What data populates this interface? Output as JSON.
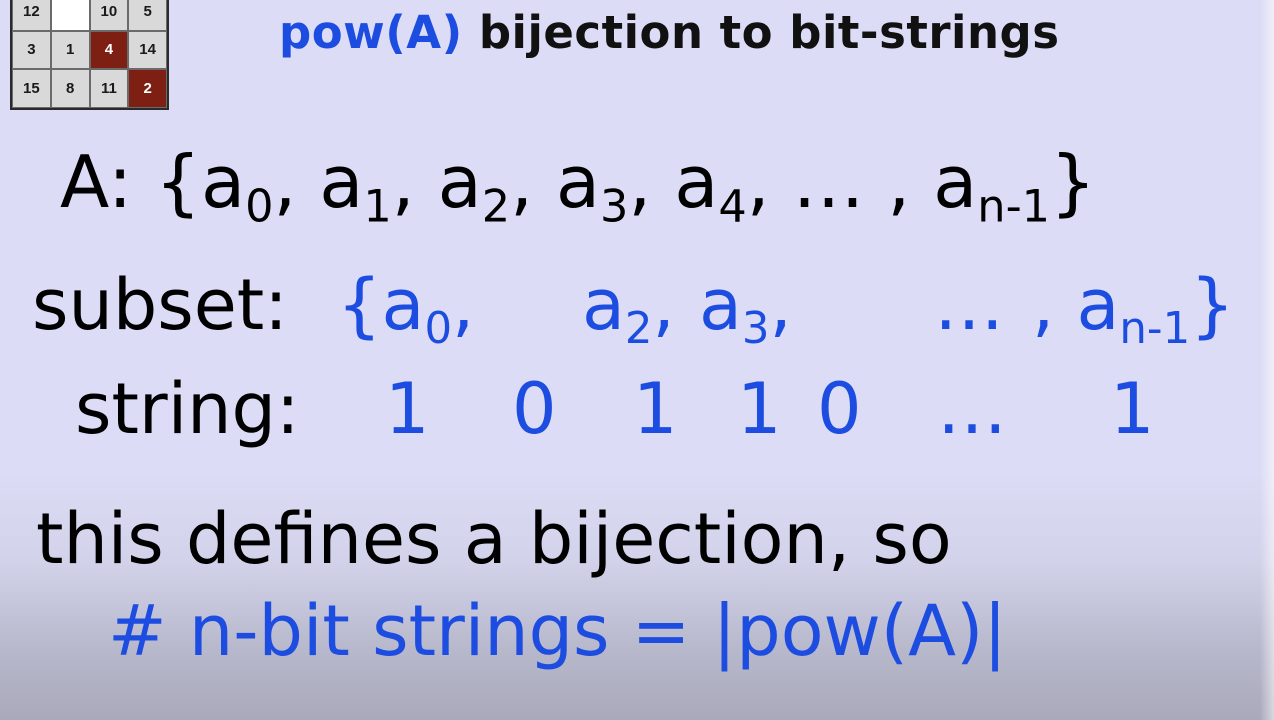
{
  "logo": {
    "tiles": [
      {
        "label": "12",
        "style": "normal"
      },
      {
        "label": "",
        "style": "blank"
      },
      {
        "label": "10",
        "style": "normal"
      },
      {
        "label": "5",
        "style": "normal"
      },
      {
        "label": "3",
        "style": "normal"
      },
      {
        "label": "1",
        "style": "normal"
      },
      {
        "label": "4",
        "style": "red"
      },
      {
        "label": "14",
        "style": "normal"
      },
      {
        "label": "15",
        "style": "normal"
      },
      {
        "label": "8",
        "style": "normal"
      },
      {
        "label": "11",
        "style": "normal"
      },
      {
        "label": "2",
        "style": "red"
      }
    ]
  },
  "title": {
    "highlight": "pow(A)",
    "rest": " bijection to bit-strings"
  },
  "set_line": {
    "prefix": "A:  {",
    "items": [
      {
        "base": "a",
        "sub": "0",
        "sep": ", "
      },
      {
        "base": "a",
        "sub": "1",
        "sep": ", "
      },
      {
        "base": "a",
        "sub": "2",
        "sep": ", "
      },
      {
        "base": "a",
        "sub": "3",
        "sep": ", "
      },
      {
        "base": "a",
        "sub": "4",
        "sep": ", … , "
      },
      {
        "base": "a",
        "sub": "n-1",
        "sep": "}"
      }
    ]
  },
  "subset_line": {
    "label": "subset:",
    "open": "{a",
    "a0_sub": "0",
    "a0_sep": ",",
    "a2": "a",
    "a2_sub": "2",
    "a2_sep": ", ",
    "a3": "a",
    "a3_sub": "3",
    "a3_sep": ",",
    "dots": "…",
    "last_prefix": ", a",
    "last_sub": "n-1",
    "close": "}"
  },
  "string_line": {
    "label": "string:",
    "bits": [
      "1",
      "0",
      "1",
      "1",
      "0"
    ],
    "dots": "…",
    "last": "1"
  },
  "conclusion": {
    "line1": "this defines a bijection, so",
    "line2": "# n-bit strings = |pow(A)|"
  },
  "colors": {
    "highlight": "#1c4de0",
    "logo_red": "#7e1f14",
    "background": "#dcdcf6"
  }
}
